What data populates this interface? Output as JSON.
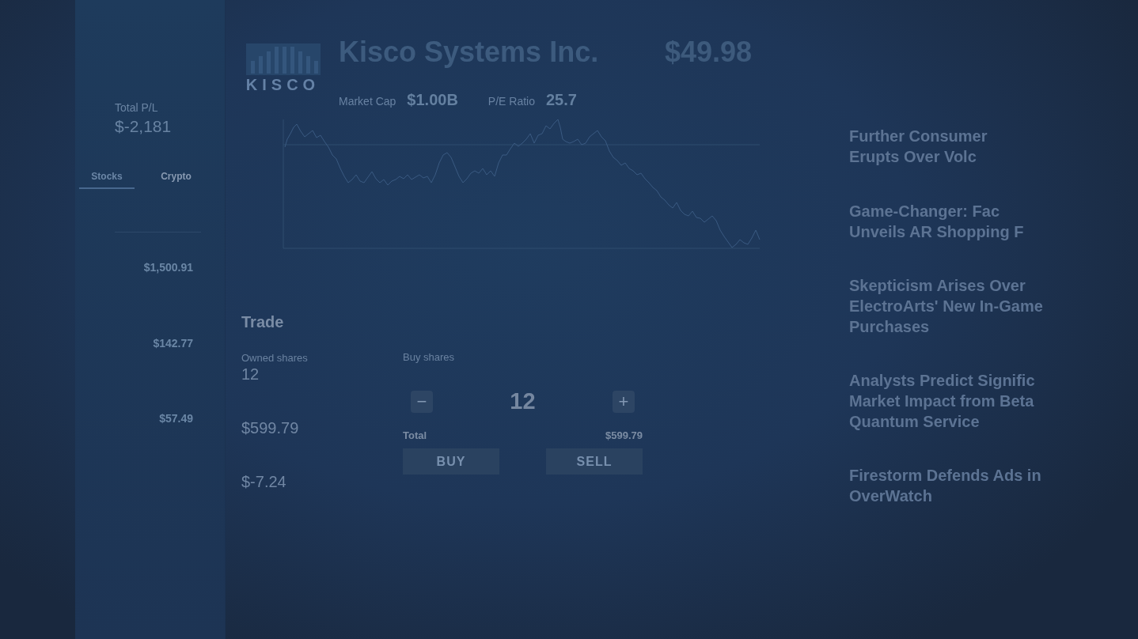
{
  "sidebar": {
    "total_pl": {
      "label": "Total P/L",
      "value": "$-2,181"
    },
    "tabs": [
      {
        "label": "Stocks",
        "selected": true
      },
      {
        "label": "Crypto",
        "selected": false
      }
    ],
    "holdings": [
      {
        "price": "$1,500.91"
      },
      {
        "price": "$142.77"
      },
      {
        "price": "$57.49"
      }
    ]
  },
  "company": {
    "logo_text": "KISCO",
    "name": "Kisco Systems Inc.",
    "stats": [
      {
        "label": "Market Cap",
        "value": "$1.00B"
      },
      {
        "label": "P/E Ratio",
        "value": "25.7"
      }
    ],
    "price": "$49.98"
  },
  "trade": {
    "title": "Trade",
    "position": [
      {
        "label": "Owned shares",
        "value": "12"
      },
      {
        "value": "$599.79"
      },
      {
        "value": "$-7.24"
      }
    ],
    "order": {
      "label": "Buy shares",
      "decrement": "−",
      "quantity": "12",
      "increment": "+",
      "total_label": "Total",
      "total": "$599.79",
      "buttons": [
        "BUY",
        "SELL"
      ]
    }
  },
  "news": [
    {
      "lines": [
        "Further Consumer",
        "Erupts Over Volc"
      ]
    },
    {
      "lines": [
        "Game-Changer: Fac",
        "Unveils AR Shopping F"
      ]
    },
    {
      "lines": [
        "Skepticism Arises Over",
        "ElectroArts' New In-Game",
        "Purchases"
      ]
    },
    {
      "lines": [
        "Analysts Predict Signific",
        "Market Impact from Beta",
        "Quantum Service"
      ]
    },
    {
      "lines": [
        "Firestorm Defends Ads in",
        "OverWatch"
      ]
    }
  ]
}
